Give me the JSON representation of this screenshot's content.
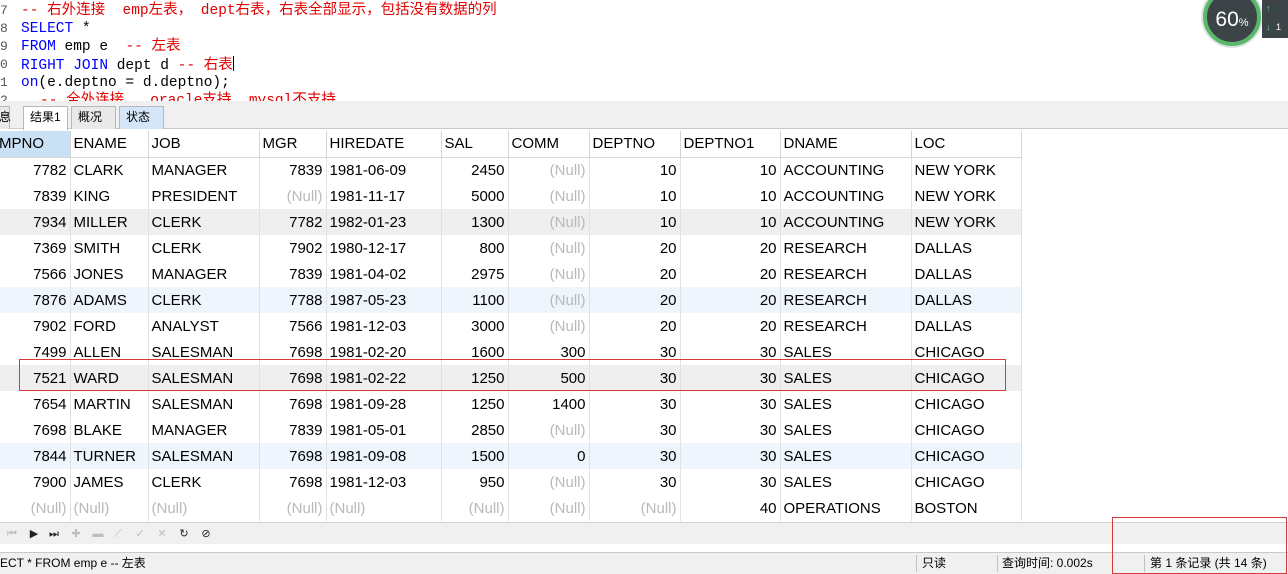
{
  "editor": {
    "lines": [
      {
        "no": "7",
        "parts": [
          {
            "t": "cm",
            "v": "-- 右外连接  emp左表， dept右表，右表全部显示，包括没有数据的列"
          }
        ]
      },
      {
        "no": "8",
        "parts": [
          {
            "t": "kw",
            "v": "SELECT"
          },
          {
            "t": "tx",
            "v": " *"
          }
        ]
      },
      {
        "no": "9",
        "parts": [
          {
            "t": "kw",
            "v": "FROM"
          },
          {
            "t": "tx",
            "v": " emp e  "
          },
          {
            "t": "cm",
            "v": "-- 左表"
          }
        ]
      },
      {
        "no": "0",
        "parts": [
          {
            "t": "kw",
            "v": "RIGHT JOIN"
          },
          {
            "t": "tx",
            "v": " dept d "
          },
          {
            "t": "cm",
            "v": "-- 右表"
          }
        ]
      },
      {
        "no": "1",
        "parts": [
          {
            "t": "kw",
            "v": "on"
          },
          {
            "t": "tx",
            "v": "(e.deptno = d.deptno);"
          }
        ]
      },
      {
        "no": "2",
        "parts": [
          {
            "t": "cm",
            "v": "-- 全外连接   oracle支持  mysql不支持"
          }
        ]
      }
    ]
  },
  "gauge": {
    "value": "60",
    "unit": "%"
  },
  "net": {
    "up": "↑",
    "down": "↓",
    "count": "1"
  },
  "tabs": [
    {
      "label": "息"
    },
    {
      "label": "结果1"
    },
    {
      "label": "概况"
    },
    {
      "label": "状态"
    }
  ],
  "grid": {
    "columns": [
      "EMPNO",
      "ENAME",
      "JOB",
      "MGR",
      "HIREDATE",
      "SAL",
      "COMM",
      "DEPTNO",
      "DEPTNO1",
      "DNAME",
      "LOC"
    ],
    "rows": [
      [
        "7782",
        "CLARK",
        "MANAGER",
        "7839",
        "1981-06-09",
        "2450",
        "(Null)",
        "10",
        "10",
        "ACCOUNTING",
        "NEW YORK"
      ],
      [
        "7839",
        "KING",
        "PRESIDENT",
        "(Null)",
        "1981-11-17",
        "5000",
        "(Null)",
        "10",
        "10",
        "ACCOUNTING",
        "NEW YORK"
      ],
      [
        "7934",
        "MILLER",
        "CLERK",
        "7782",
        "1982-01-23",
        "1300",
        "(Null)",
        "10",
        "10",
        "ACCOUNTING",
        "NEW YORK"
      ],
      [
        "7369",
        "SMITH",
        "CLERK",
        "7902",
        "1980-12-17",
        "800",
        "(Null)",
        "20",
        "20",
        "RESEARCH",
        "DALLAS"
      ],
      [
        "7566",
        "JONES",
        "MANAGER",
        "7839",
        "1981-04-02",
        "2975",
        "(Null)",
        "20",
        "20",
        "RESEARCH",
        "DALLAS"
      ],
      [
        "7876",
        "ADAMS",
        "CLERK",
        "7788",
        "1987-05-23",
        "1100",
        "(Null)",
        "20",
        "20",
        "RESEARCH",
        "DALLAS"
      ],
      [
        "7902",
        "FORD",
        "ANALYST",
        "7566",
        "1981-12-03",
        "3000",
        "(Null)",
        "20",
        "20",
        "RESEARCH",
        "DALLAS"
      ],
      [
        "7499",
        "ALLEN",
        "SALESMAN",
        "7698",
        "1981-02-20",
        "1600",
        "300",
        "30",
        "30",
        "SALES",
        "CHICAGO"
      ],
      [
        "7521",
        "WARD",
        "SALESMAN",
        "7698",
        "1981-02-22",
        "1250",
        "500",
        "30",
        "30",
        "SALES",
        "CHICAGO"
      ],
      [
        "7654",
        "MARTIN",
        "SALESMAN",
        "7698",
        "1981-09-28",
        "1250",
        "1400",
        "30",
        "30",
        "SALES",
        "CHICAGO"
      ],
      [
        "7698",
        "BLAKE",
        "MANAGER",
        "7839",
        "1981-05-01",
        "2850",
        "(Null)",
        "30",
        "30",
        "SALES",
        "CHICAGO"
      ],
      [
        "7844",
        "TURNER",
        "SALESMAN",
        "7698",
        "1981-09-08",
        "1500",
        "0",
        "30",
        "30",
        "SALES",
        "CHICAGO"
      ],
      [
        "7900",
        "JAMES",
        "CLERK",
        "7698",
        "1981-12-03",
        "950",
        "(Null)",
        "30",
        "30",
        "SALES",
        "CHICAGO"
      ],
      [
        "(Null)",
        "(Null)",
        "(Null)",
        "(Null)",
        "(Null)",
        "(Null)",
        "(Null)",
        "(Null)",
        "40",
        "OPERATIONS",
        "BOSTON"
      ]
    ]
  },
  "nav_buttons": [
    {
      "icon": "first-record-icon",
      "glyph": "⏮",
      "enabled": false
    },
    {
      "icon": "next-record-icon",
      "glyph": "▶",
      "enabled": true
    },
    {
      "icon": "last-record-icon",
      "glyph": "⏭",
      "enabled": true
    },
    {
      "icon": "insert-record-icon",
      "glyph": "✚",
      "enabled": false
    },
    {
      "icon": "delete-record-icon",
      "glyph": "▬",
      "enabled": false
    },
    {
      "icon": "edit-record-icon",
      "glyph": "⟋",
      "enabled": false
    },
    {
      "icon": "apply-changes-icon",
      "glyph": "✓",
      "enabled": false
    },
    {
      "icon": "cancel-changes-icon",
      "glyph": "✕",
      "enabled": false
    },
    {
      "icon": "refresh-icon",
      "glyph": "↻",
      "enabled": true
    },
    {
      "icon": "stop-icon",
      "glyph": "⊘",
      "enabled": true
    }
  ],
  "status": {
    "sql": "ECT *  FROM emp e  -- 左表",
    "mode": "只读",
    "query_time": "查询时间: 0.002s",
    "record": "第 1 条记录 (共 14 条)"
  },
  "colors": {
    "keyword": "#0000ff",
    "comment": "#e00000",
    "highlight_outline": "#d83a3a",
    "selected_header": "#c9e0f5"
  }
}
